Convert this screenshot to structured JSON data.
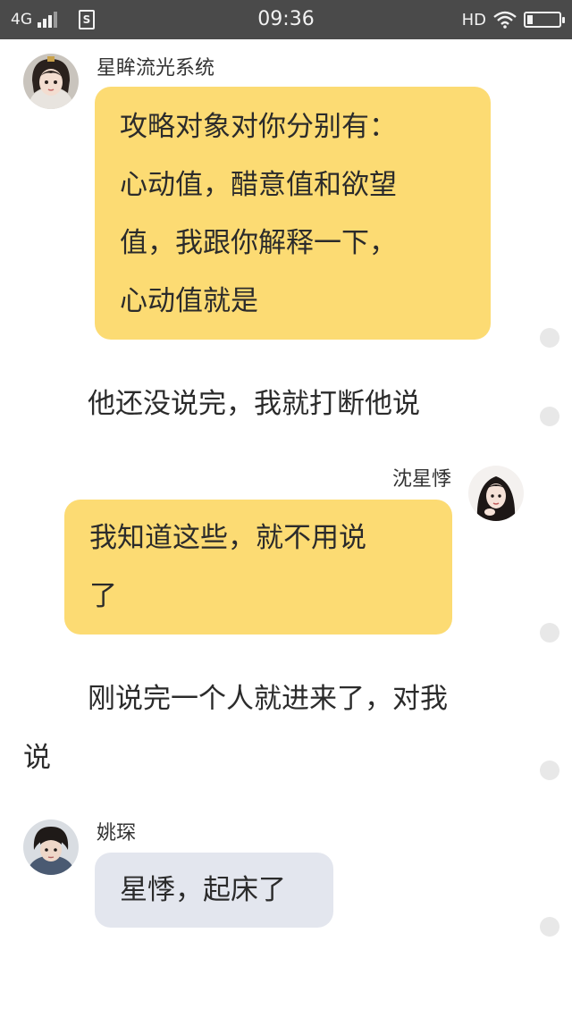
{
  "status_bar": {
    "network": "4G",
    "sim_icon_text": "S",
    "time": "09:36",
    "hd": "HD",
    "icons": [
      "signal-icon",
      "sim-icon",
      "wifi-icon",
      "battery-icon"
    ],
    "battery_level": 0.15
  },
  "messages": [
    {
      "sender": "星眸流光系统",
      "side": "left",
      "bubble_color": "#fcdb73",
      "lines": [
        "攻略对象对你分别有：",
        "心动值，醋意值和欲望",
        "值，我跟你解释一下，",
        "心动值就是"
      ]
    },
    {
      "narration": [
        "他还没说完，我就打断他说"
      ]
    },
    {
      "sender": "沈星悸",
      "side": "right",
      "bubble_color": "#fcdb73",
      "lines": [
        "我知道这些，就不用说",
        "了"
      ]
    },
    {
      "narration": [
        "刚说完一个人就进来了，对我",
        "说"
      ]
    },
    {
      "sender": "姚琛",
      "side": "left",
      "bubble_color": "#e3e6ee",
      "lines": [
        "星悸，起床了"
      ]
    }
  ]
}
